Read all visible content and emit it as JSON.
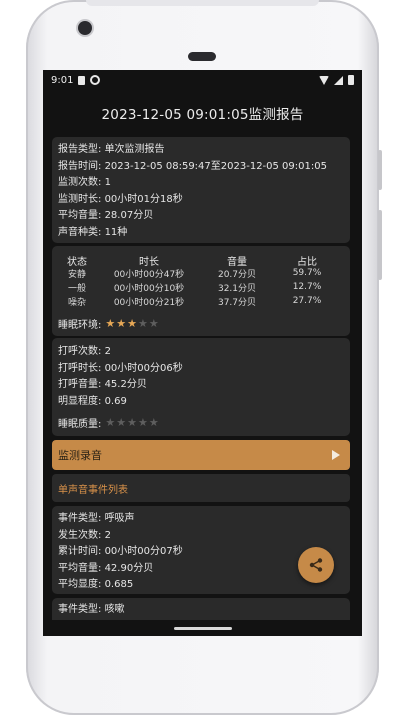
{
  "status_bar": {
    "time": "9:01"
  },
  "header": {
    "title": "2023-12-05 09:01:05监测报告"
  },
  "summary": {
    "rows": [
      {
        "label": "报告类型: ",
        "value": "单次监测报告"
      },
      {
        "label": "报告时间: ",
        "value": "2023-12-05 08:59:47至2023-12-05 09:01:05"
      },
      {
        "label": "监测次数: ",
        "value": "1"
      },
      {
        "label": "监测时长: ",
        "value": "00小时01分18秒"
      },
      {
        "label": "平均音量: ",
        "value": "28.07分贝"
      },
      {
        "label": "声音种类: ",
        "value": "11种"
      }
    ]
  },
  "environment": {
    "columns": [
      "状态",
      "时长",
      "音量",
      "占比"
    ],
    "rows": [
      [
        "安静",
        "00小时00分47秒",
        "20.7分贝",
        "59.7%"
      ],
      [
        "一般",
        "00小时00分10秒",
        "32.1分贝",
        "12.7%"
      ],
      [
        "噪杂",
        "00小时00分21秒",
        "37.7分贝",
        "27.7%"
      ]
    ],
    "rating_label": "睡眠环境: ",
    "rating": 3,
    "rating_max": 5
  },
  "snoring": {
    "rows": [
      {
        "label": "打呼次数: ",
        "value": "2"
      },
      {
        "label": "打呼时长: ",
        "value": "00小时00分06秒"
      },
      {
        "label": "打呼音量: ",
        "value": "45.2分贝"
      },
      {
        "label": "明显程度: ",
        "value": "0.69"
      }
    ],
    "quality_label": "睡眠质量: ",
    "quality_rating": 0,
    "quality_max": 5
  },
  "record_button": {
    "label": "监测录音"
  },
  "event_list": {
    "header": "单声音事件列表",
    "events": [
      {
        "rows": [
          {
            "label": "事件类型: ",
            "value": "呼吸声"
          },
          {
            "label": "发生次数: ",
            "value": "2"
          },
          {
            "label": "累计时间: ",
            "value": "00小时00分07秒"
          },
          {
            "label": "平均音量: ",
            "value": "42.90分贝"
          },
          {
            "label": "平均显度: ",
            "value": "0.685"
          }
        ]
      },
      {
        "rows": [
          {
            "label": "事件类型: ",
            "value": "咳嗽"
          }
        ]
      }
    ]
  },
  "colors": {
    "accent": "#c68a48",
    "accent_text": "#d9924a",
    "star_on": "#e7a856",
    "star_off": "#5e5e5e",
    "background": "#121212",
    "card": "#2a2a2a"
  },
  "icons": {
    "share": "share-icon",
    "play": "play-arrow-icon",
    "star": "star-icon"
  }
}
